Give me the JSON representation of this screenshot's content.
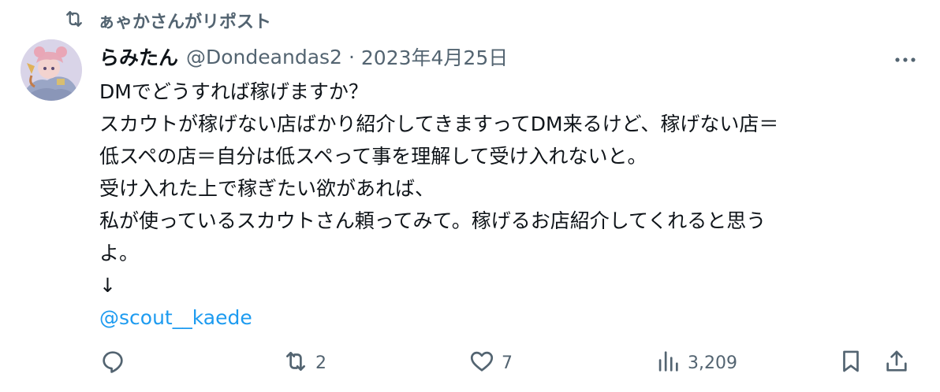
{
  "repost": {
    "icon": "repost-icon",
    "text": "ぁゃかさんがリポスト"
  },
  "tweet": {
    "avatar_icon": "avatar-illustration",
    "display_name": "らみたん",
    "handle": "@Dondeandas2",
    "separator": "·",
    "date": "2023年4月25日",
    "more_icon": "more-dots-icon",
    "lines": [
      "DMでどうすれば稼げますか？",
      "スカウトが稼げない店ばかり紹介してきますってDM来るけど、稼げない店＝",
      "低スペの店＝自分は低スペって事を理解して受け入れないと。",
      "受け入れた上で稼ぎたい欲があれば、",
      "私が使っているスカウトさん頼ってみて。稼げるお店紹介してくれると思う",
      "よ。",
      "↓"
    ],
    "mention": "@scout__kaede"
  },
  "actions": {
    "reply": {
      "icon": "reply-icon",
      "count": ""
    },
    "repost": {
      "icon": "repost-icon",
      "count": "2"
    },
    "like": {
      "icon": "heart-icon",
      "count": "7"
    },
    "views": {
      "icon": "views-bar-chart-icon",
      "count": "3,209"
    },
    "bookmark": {
      "icon": "bookmark-icon"
    },
    "share": {
      "icon": "share-upload-icon"
    }
  },
  "colors": {
    "text_primary": "#0f1419",
    "text_secondary": "#536471",
    "link": "#1d9bf0",
    "background": "#ffffff"
  }
}
